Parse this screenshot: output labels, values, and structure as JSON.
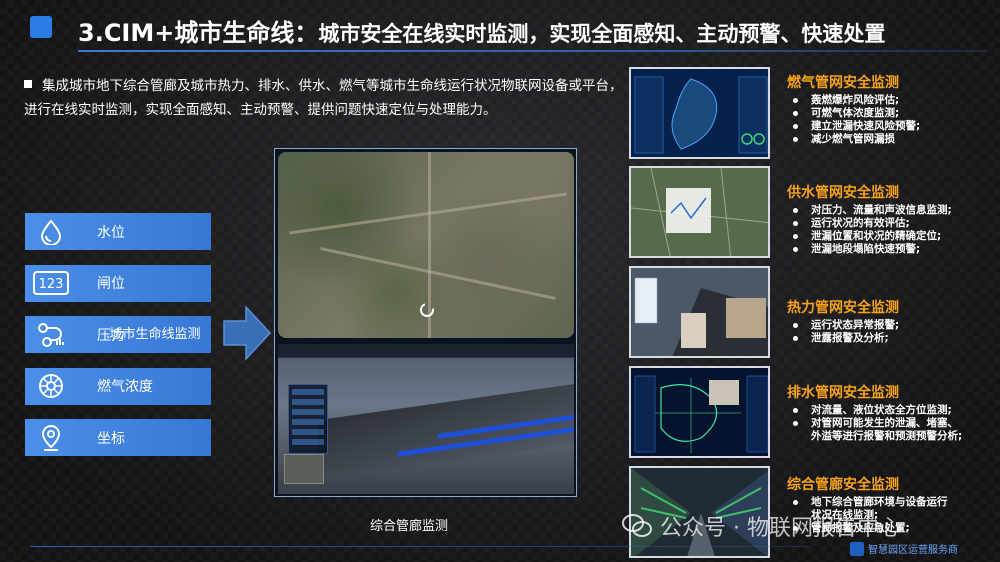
{
  "header": {
    "title_main": "3.CIM+城市生命线：",
    "title_sub": "城市安全在线实时监测，实现全面感知、主动预警、快速处置"
  },
  "intro": "集成城市地下综合管廊及城市热力、排水、供水、燃气等城市生命线运行状况物联网设备或平台，进行在线实时监测，实现全面感知、主动预警、提供问题快速定位与处理能力。",
  "params": [
    {
      "label": "水位",
      "icon": "water-drop-icon"
    },
    {
      "label": "闸位",
      "icon": "number-123-icon"
    },
    {
      "label": "压力",
      "icon": "pressure-pipe-icon"
    },
    {
      "label": "燃气浓度",
      "icon": "gas-sensor-icon"
    },
    {
      "label": "坐标",
      "icon": "location-pin-icon"
    }
  ],
  "center": {
    "caption_top": "城市生命线监测",
    "caption_bottom": "综合管廊监测"
  },
  "sections": [
    {
      "title": "燃气管网安全监测",
      "items": [
        "轰燃爆炸风险评估;",
        "可燃气体浓度监测;",
        "建立泄漏快速风险预警;",
        "减少燃气管网漏损"
      ]
    },
    {
      "title": "供水管网安全监测",
      "items": [
        "对压力、流量和声波信息监测;",
        "运行状况的有效评估;",
        "泄漏位置和状况的精确定位;",
        "泄漏地段塌陷快速预警;"
      ]
    },
    {
      "title": "热力管网安全监测",
      "items": [
        "运行状态异常报警;",
        "泄露报警及分析;"
      ]
    },
    {
      "title": "排水管网安全监测",
      "items": [
        "对流量、液位状态全方位监测;",
        "对管网可能发生的泄漏、堵塞、",
        "外溢等进行报警和预测预警分析;"
      ]
    },
    {
      "title": "综合管廊安全监测",
      "items": [
        "地下综合管廊环境与设备运行",
        "状况在线监测;",
        "管廊报警及应急处置;"
      ]
    }
  ],
  "watermark": "公众号 · 物联网报告中心",
  "brand": "智慧园区运营服务商",
  "colors": {
    "accent_blue": "#3778d6",
    "section_title": "#f7a21b",
    "background": "#1a1a1d"
  }
}
